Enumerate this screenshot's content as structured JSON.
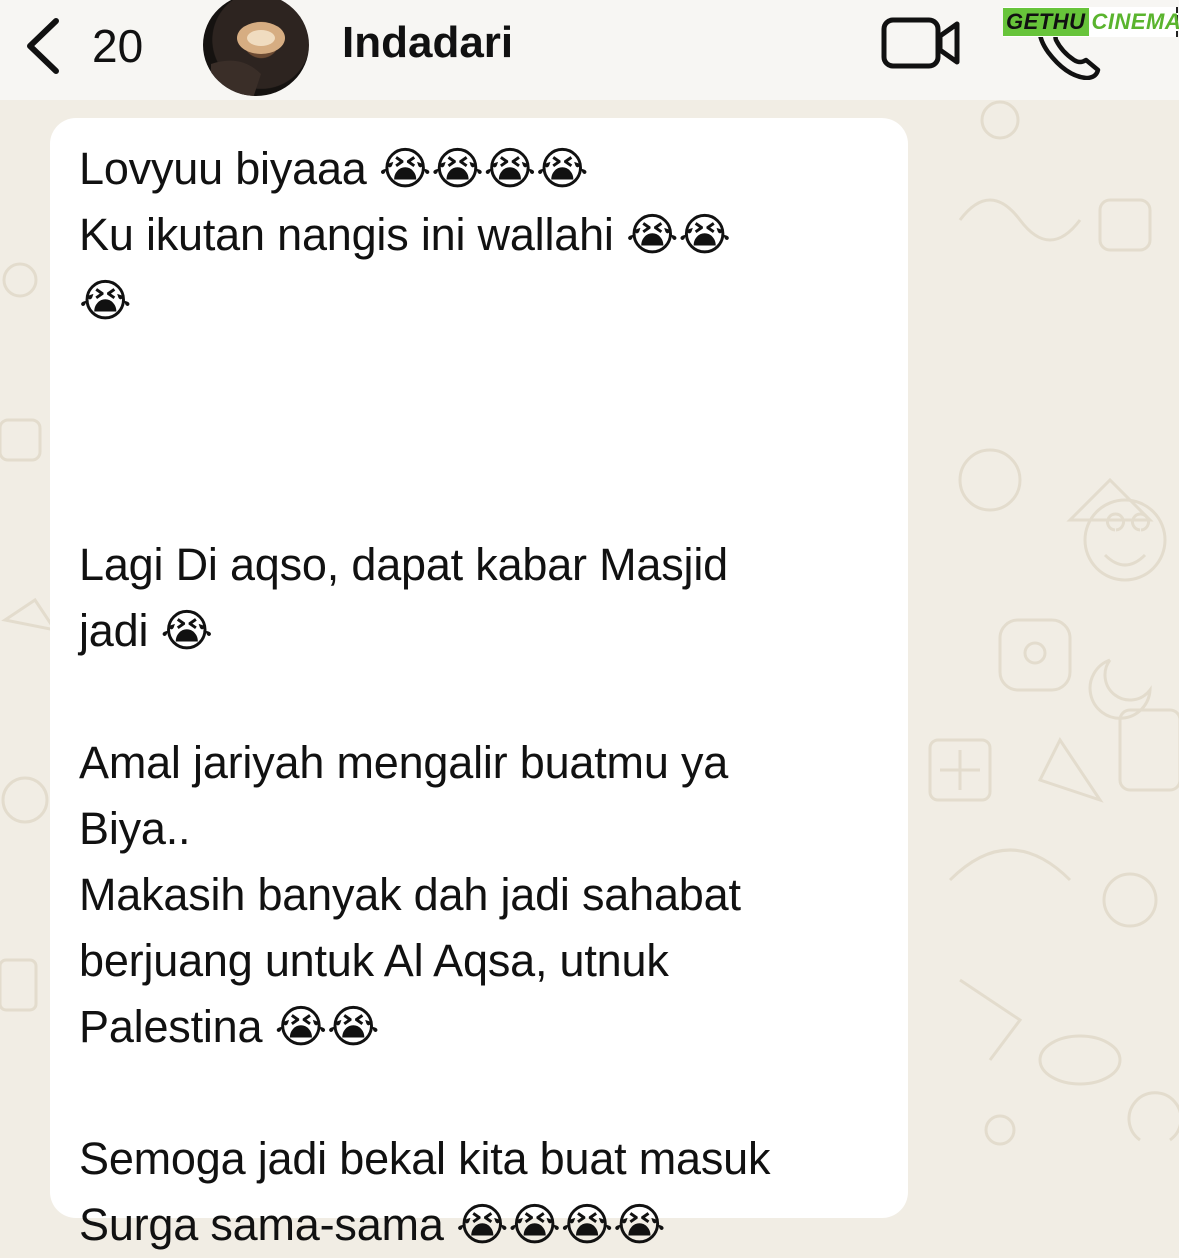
{
  "header": {
    "back_count": "20",
    "contact_name": "Indadari",
    "watermark_part1": "GETHU",
    "watermark_part2": "CINEMA"
  },
  "message": {
    "text": "Lovyuu biyaaa 😭😭😭😭\nKu ikutan nangis ini wallahi 😭😭\n😭\n\n\n\nLagi Di aqso, dapat kabar Masjid\njadi 😭\n\nAmal jariyah mengalir buatmu ya\nBiya..\nMakasih banyak dah jadi sahabat\nberjuang untuk Al Aqsa, utnuk\nPalestina 😭😭\n\nSemoga jadi bekal kita buat masuk\nSurga sama-sama 😭😭😭😭"
  },
  "colors": {
    "background": "#f1ede4",
    "bubble": "#ffffff",
    "header": "#f7f6f3",
    "watermark_green": "#67c43a"
  },
  "icons": [
    "chevron-left-icon",
    "video-call-icon",
    "phone-icon"
  ]
}
